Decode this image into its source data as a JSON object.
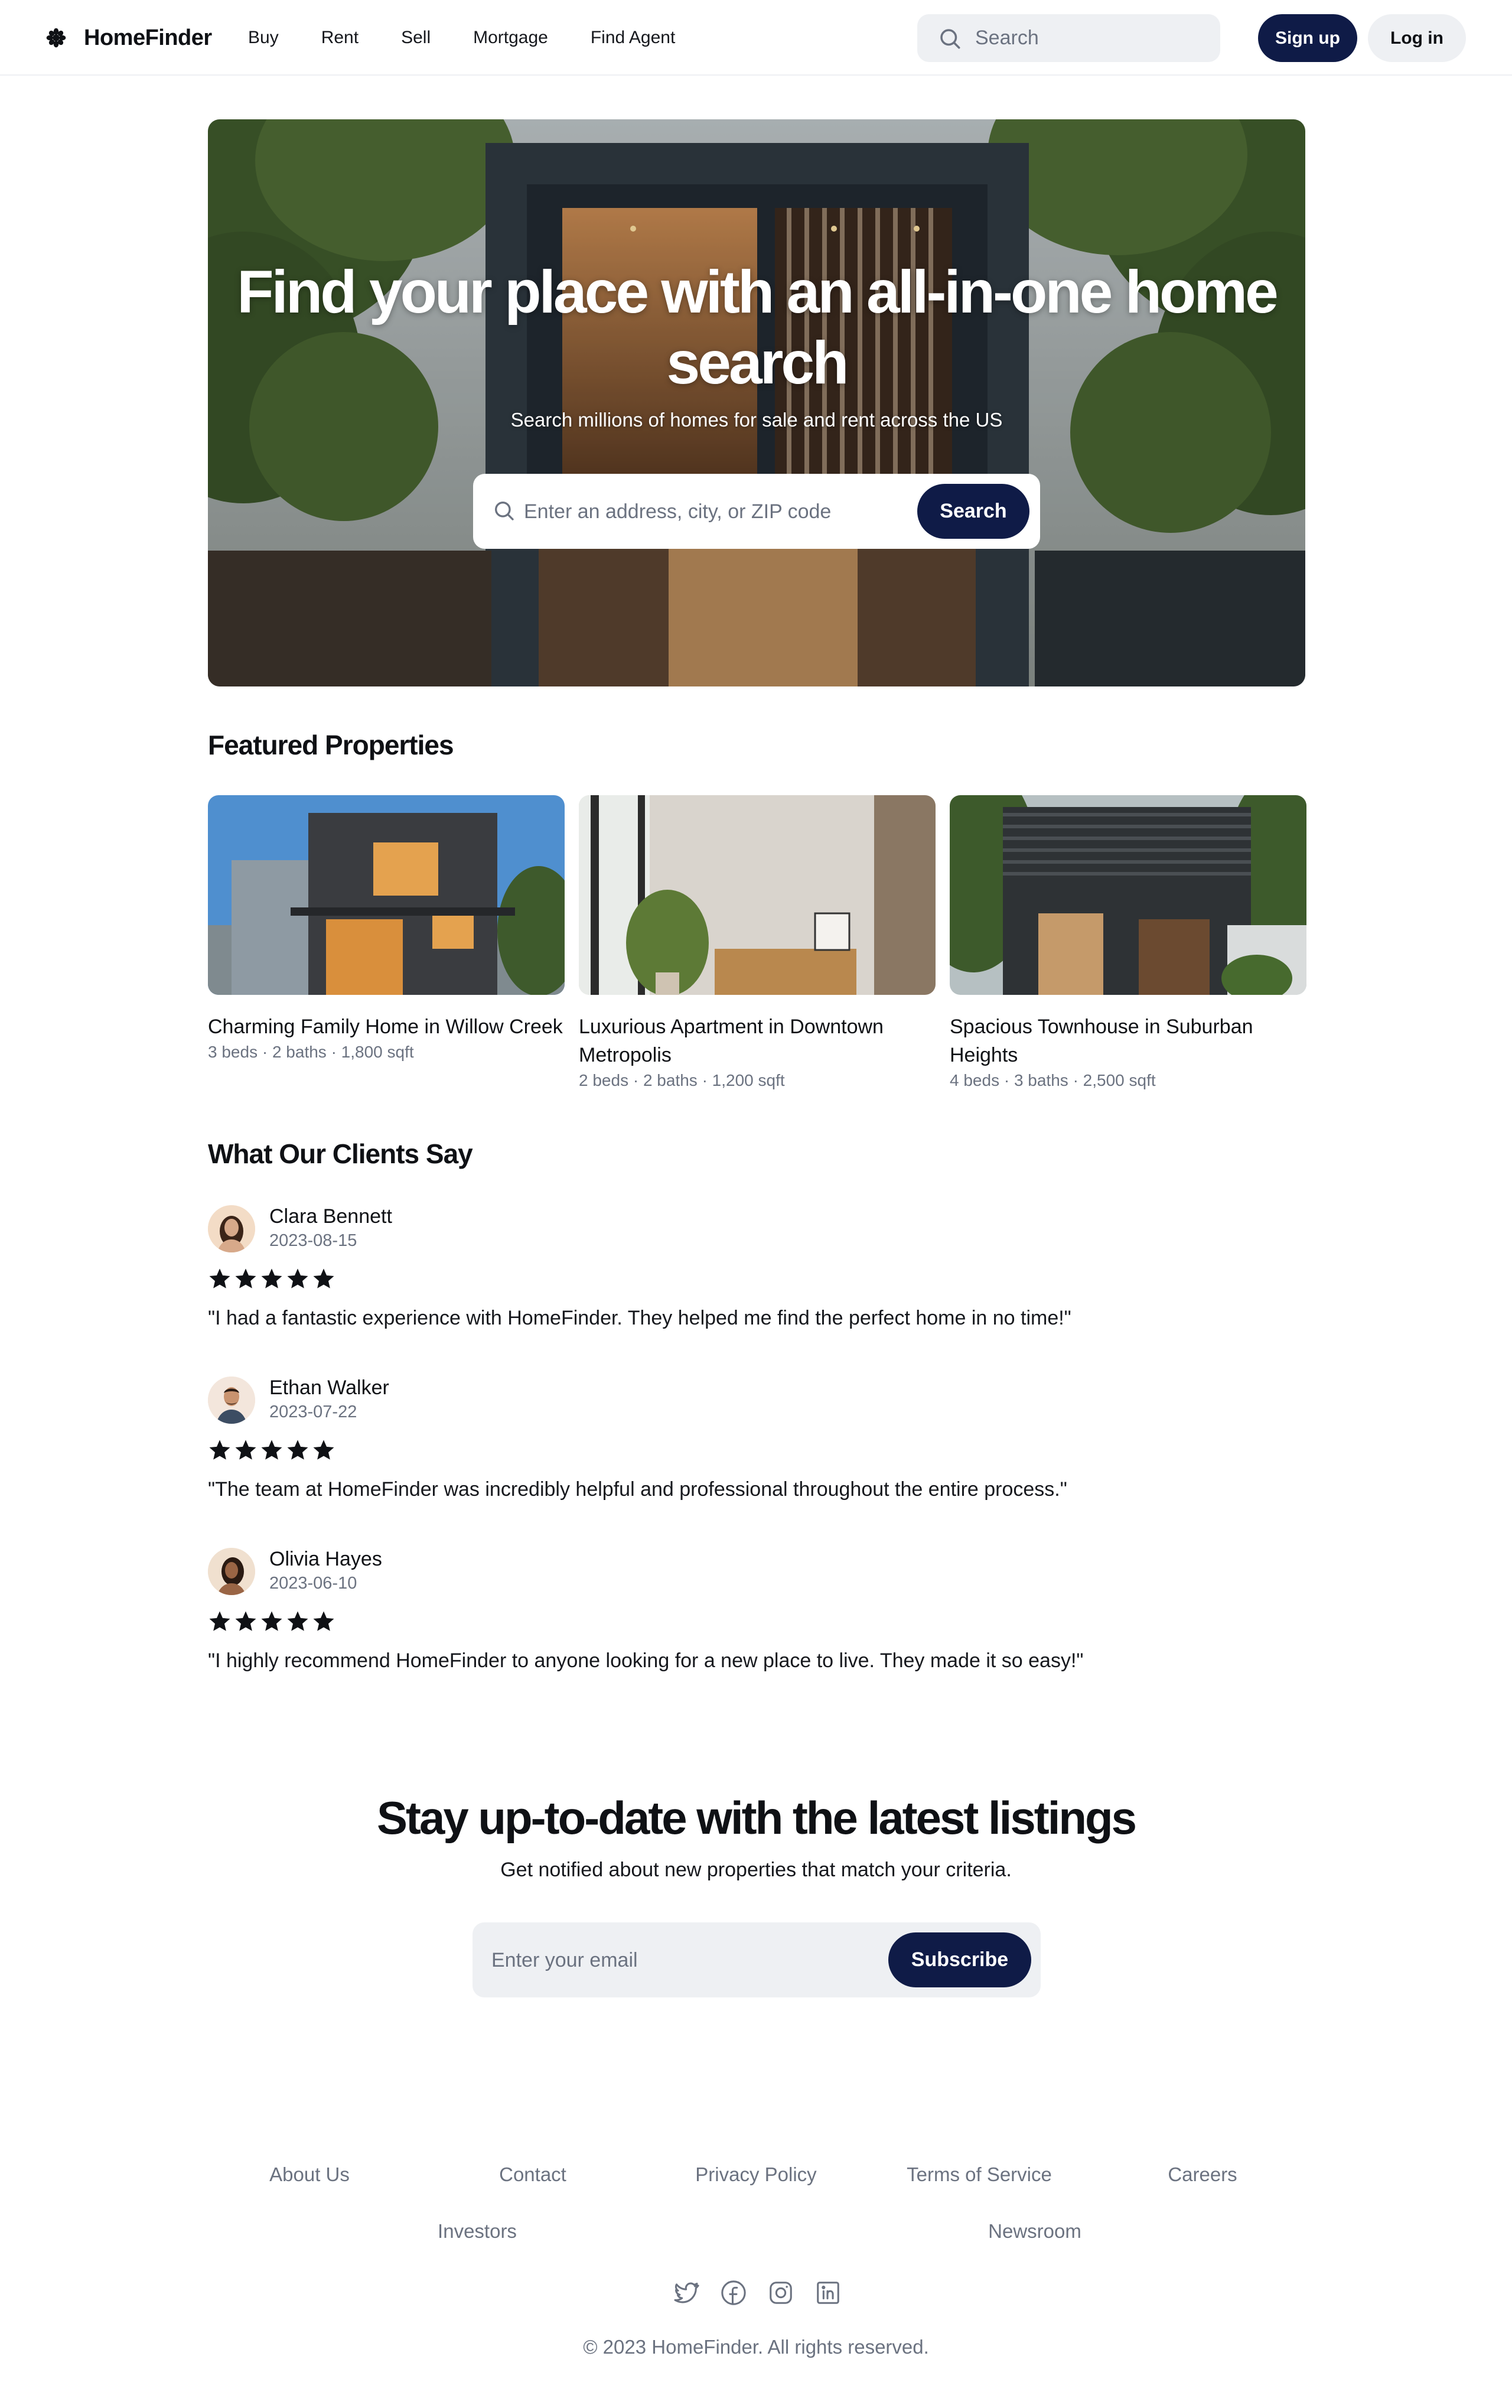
{
  "header": {
    "logo_text": "HomeFinder",
    "nav": [
      "Buy",
      "Rent",
      "Sell",
      "Mortgage",
      "Find Agent"
    ],
    "search_placeholder": "Search",
    "signup_label": "Sign up",
    "login_label": "Log in"
  },
  "hero": {
    "title": "Find your place with an all-in-one home search",
    "subtitle": "Search millions of homes for sale and rent across the US",
    "search_placeholder": "Enter an address, city, or ZIP code",
    "search_button": "Search"
  },
  "featured": {
    "title": "Featured Properties",
    "cards": [
      {
        "title": "Charming Family Home in Willow Creek",
        "meta": "3 beds · 2 baths · 1,800 sqft"
      },
      {
        "title": "Luxurious Apartment in Downtown Metropolis",
        "meta": "2 beds · 2 baths · 1,200 sqft"
      },
      {
        "title": "Spacious Townhouse in Suburban Heights",
        "meta": "4 beds · 3 baths · 2,500 sqft"
      }
    ]
  },
  "testimonials": {
    "title": "What Our Clients Say",
    "items": [
      {
        "name": "Clara Bennett",
        "date": "2023-08-15",
        "rating": 5,
        "text": "\"I had a fantastic experience with HomeFinder. They helped me find the perfect home in no time!\""
      },
      {
        "name": "Ethan Walker",
        "date": "2023-07-22",
        "rating": 5,
        "text": "\"The team at HomeFinder was incredibly helpful and professional throughout the entire process.\""
      },
      {
        "name": "Olivia Hayes",
        "date": "2023-06-10",
        "rating": 5,
        "text": "\"I highly recommend HomeFinder to anyone looking for a new place to live. They made it so easy!\""
      }
    ]
  },
  "newsletter": {
    "title": "Stay up-to-date with the latest listings",
    "subtitle": "Get notified about new properties that match your criteria.",
    "email_placeholder": "Enter your email",
    "button": "Subscribe"
  },
  "footer": {
    "links": [
      "About Us",
      "Contact",
      "Privacy Policy",
      "Terms of Service",
      "Careers",
      "Investors",
      "Newsroom"
    ],
    "social_icons": [
      "twitter-icon",
      "facebook-icon",
      "instagram-icon",
      "linkedin-icon"
    ],
    "copyright": "© 2023 HomeFinder. All rights reserved."
  },
  "colors": {
    "accent": "#0f1b47",
    "muted_text": "#6b7280",
    "input_bg": "#eef0f3"
  }
}
